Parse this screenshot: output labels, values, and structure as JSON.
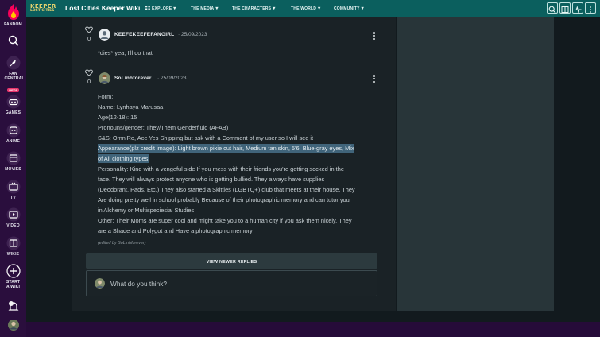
{
  "global_nav": {
    "fandom": "FANDOM",
    "fan_central": "FAN CENTRAL",
    "beta": "BETA",
    "games": "GAMES",
    "anime": "ANIME",
    "movies": "MOVIES",
    "tv": "TV",
    "video": "VIDEO",
    "wikis": "WIKIS",
    "start_a_wiki": "START A WIKI"
  },
  "header": {
    "logo_line1": "KEEPER",
    "logo_line2": "LOST CITIES",
    "wiki_name": "Lost Cities Keeper Wiki",
    "nav": [
      {
        "label": "EXPLORE"
      },
      {
        "label": "THE MEDIA"
      },
      {
        "label": "THE CHARACTERS"
      },
      {
        "label": "THE WORLD"
      },
      {
        "label": "COMMUNITY"
      }
    ]
  },
  "replies": [
    {
      "votes": "0",
      "author": "KEEFEKEEFEFANGIRL",
      "date": "25/09/2023",
      "lines": [
        "*dies* yea, I'll do that"
      ]
    },
    {
      "votes": "0",
      "author": "SoLinhforever",
      "date": "25/09/2023",
      "lines": [
        "Form:",
        "Name: Lynhaya Marusaa",
        "Age(12-18): 15",
        "Pronouns/gender: They/Them Genderfluid (AFAB)",
        "S&S: OmniRo, Ace Yes Shipping but ask with a Comment of my user so I will see it",
        "Appearance(plz credit image): Light brown pixie cut hair, Medium tan skin, 5'6, Blue-gray eyes, Mix",
        "of All clothing types.",
        "Personality: Kind with a vengeful side If you mess with their friends you're getting socked in the",
        "face. They will always protect anyone who is getting bullied. They always have supplies",
        "(Deodorant, Pads, Etc.)  They also started a Skittles (LGBTQ+) club that meets at their house. They",
        "Are doing pretty well in school probably Because of their photographic memory and can tutor you",
        "in Alchemy or Multispeciesial Studies",
        "Other: Their Moms are super cool and might take you to a human city if you ask them nicely. They",
        "are a Shade and Polygot and Have a photographic memory"
      ],
      "edited": "(edited by SoLinhforever)"
    }
  ],
  "view_newer_replies": "VIEW NEWER REPLIES",
  "reply_placeholder": "What do you think?",
  "colors": {
    "header_bg": "#0b5f5e",
    "global_nav_bg": "#2a0e3d",
    "highlight": "#40647a",
    "logo_gold": "#e7d36e"
  }
}
